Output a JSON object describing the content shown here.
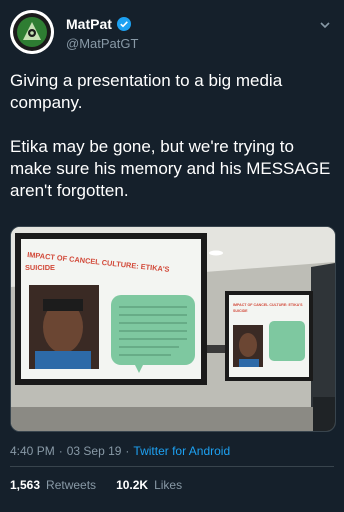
{
  "tweet": {
    "display_name": "MatPat",
    "handle": "@MatPatGT",
    "verified": true,
    "paragraphs": [
      "Giving a presentation to a big media company.",
      "Etika may be gone, but we're trying to make sure his memory and his MESSAGE aren't forgotten."
    ],
    "time": "4:40 PM",
    "date": "03 Sep 19",
    "source": "Twitter for Android",
    "retweets_count": "1,563",
    "retweets_label": "Retweets",
    "likes_count": "10.2K",
    "likes_label": "Likes"
  },
  "media": {
    "slide_title_line1": "IMPACT OF CANCEL CULTURE: ETIKA'S",
    "slide_title_line2": "SUICIDE",
    "right_slide_title_line1": "IMPACT OF CANCEL CULTURE: ETIKA'S",
    "right_slide_title_line2": "SUICIDE"
  },
  "colors": {
    "background": "#15202b",
    "secondary_text": "#8899a6",
    "link": "#1da1f2",
    "verified": "#1da1f2",
    "slide_green": "#7ec8a0"
  }
}
